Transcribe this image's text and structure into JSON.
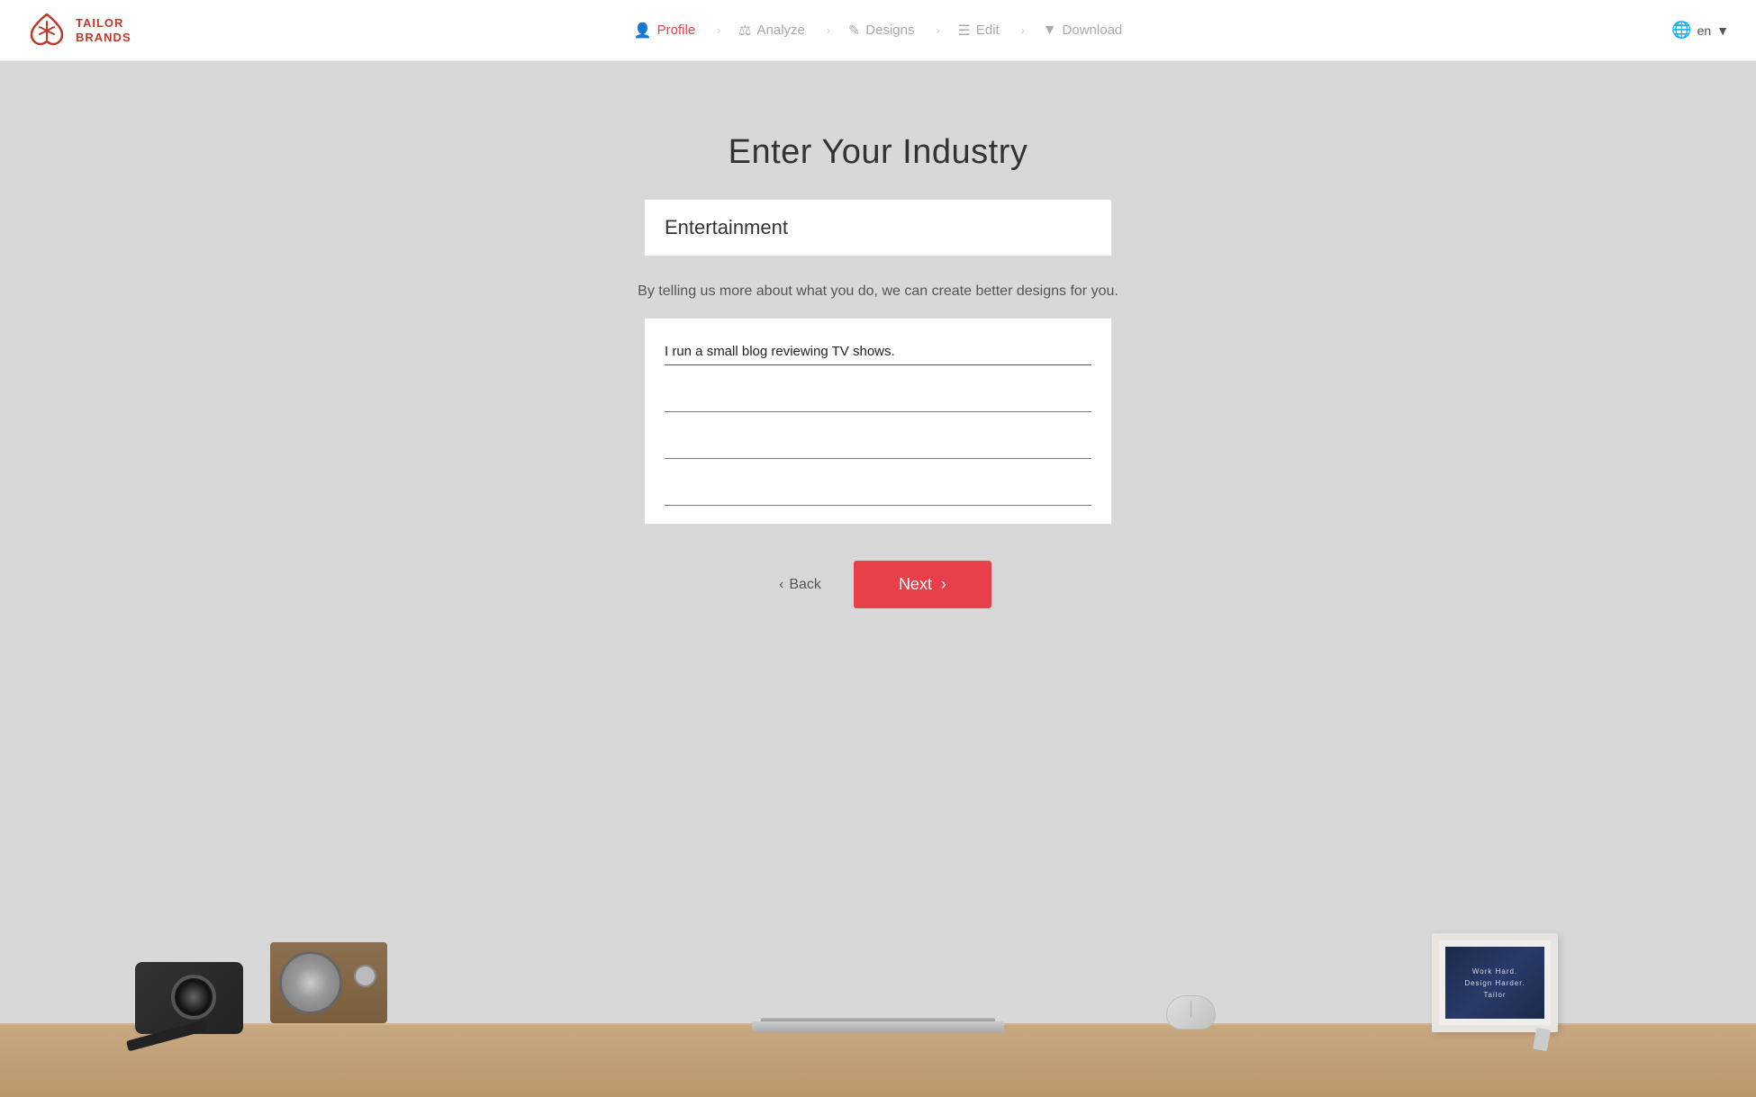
{
  "brand": {
    "name_line1": "TAILOR",
    "name_line2": "BRANDS"
  },
  "header": {
    "nav_items": [
      {
        "id": "profile",
        "label": "Profile",
        "active": true
      },
      {
        "id": "analyze",
        "label": "Analyze",
        "active": false
      },
      {
        "id": "designs",
        "label": "Designs",
        "active": false
      },
      {
        "id": "edit",
        "label": "Edit",
        "active": false
      },
      {
        "id": "download",
        "label": "Download",
        "active": false
      }
    ],
    "lang": "en"
  },
  "main": {
    "title": "Enter Your Industry",
    "industry_value": "Entertainment",
    "subtitle": "By telling us more about what you do, we can create better designs for you.",
    "description_text": "I run a small blog reviewing TV shows.",
    "back_label": "Back",
    "next_label": "Next"
  }
}
